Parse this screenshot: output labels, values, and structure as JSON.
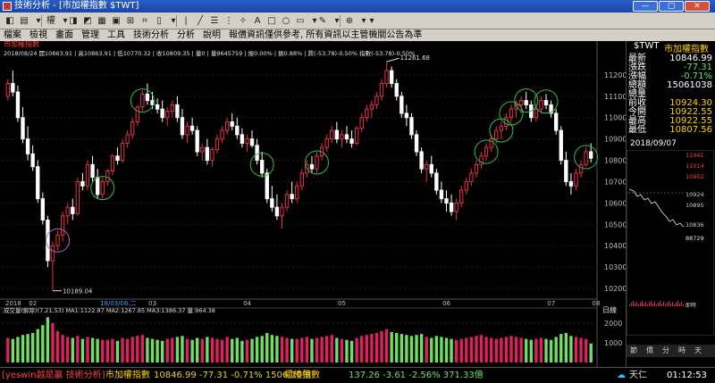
{
  "window": {
    "title": "技術分析 - [市加權指數 $TWT]"
  },
  "toolbar": {
    "items": [
      {
        "label": "◧"
      },
      {
        "label": "▤"
      },
      {
        "label": "▾"
      },
      {
        "label": "權"
      },
      {
        "label": "▾"
      },
      {
        "label": "◨"
      },
      {
        "label": "◩"
      },
      {
        "label": "▦"
      },
      {
        "label": "▣"
      },
      {
        "label": "⊞"
      },
      {
        "label": "⌗"
      },
      {
        "label": "▯"
      },
      {
        "label": "▾"
      },
      {
        "label": "|"
      },
      {
        "label": "╱"
      },
      {
        "label": "☰"
      },
      {
        "label": "⋮"
      },
      {
        "label": "✧"
      },
      {
        "label": "A"
      },
      {
        "label": "□"
      },
      {
        "label": "○"
      },
      {
        "label": "▭"
      },
      {
        "label": "▾"
      },
      {
        "label": "✎"
      },
      {
        "label": "▾"
      },
      {
        "label": "⊕"
      },
      {
        "label": "▾"
      },
      {
        "label": "▾"
      }
    ]
  },
  "menu": {
    "items": [
      "檔案",
      "檢視",
      "畫面",
      "管理",
      "工具",
      "技術分析",
      "分析",
      "說明",
      "報價資訊僅供參考, 所有資訊以主管機關公告為準"
    ]
  },
  "chart": {
    "subtitle": "市加權指數",
    "info_line": "2018/08/24  開10863.91 | 高10863.91 | 低10770.32 | 收10809.35 | 量0 | 量9645759 | 振0.00% | 振0.88% | 跌(-53.78)-0.50%  指數(-53.78)-0.50%",
    "high_label": "11261.68",
    "low_label": "10189.04",
    "price_ticks": [
      "11200",
      "11100",
      "11000",
      "10900",
      "10800",
      "10700",
      "10600",
      "10500",
      "10400",
      "10300",
      "10200"
    ],
    "month_labels": [
      "2018",
      "02",
      "03",
      "04",
      "05",
      "06",
      "07",
      "08"
    ],
    "date_marker": "18/03/06,二",
    "volume_title": "成交量(解除)(7,21,53)  MA1:1122.87  MA2:1267.85  MA3:1386.37  量:964.38",
    "volume_scale": "日線",
    "volume_ticks": [
      "2000",
      "1000"
    ]
  },
  "quote": {
    "symbol": "$TWT",
    "name": "市加權指數",
    "rows": [
      {
        "label": "最新",
        "value": "10846.99"
      },
      {
        "label": "漲跌",
        "value": "-77.31"
      },
      {
        "label": "漲幅",
        "value": "-0.71%"
      },
      {
        "label": "總額",
        "value": "15061038"
      },
      {
        "label": "總量",
        "value": ""
      },
      {
        "label": "前收",
        "value": "10924.30"
      },
      {
        "label": "今開",
        "value": "10922.55"
      },
      {
        "label": "最高",
        "value": "10922.55"
      },
      {
        "label": "最低",
        "value": "10807.56"
      }
    ],
    "date": "2018/09/07",
    "mini_labels": [
      "11041",
      "11014",
      "10952",
      "10924",
      "10895",
      "10836",
      "88729"
    ],
    "mini_axis": "即時",
    "tabs": [
      "節",
      "價",
      "分",
      "時",
      "天"
    ]
  },
  "colors": {
    "up": "#e8304a",
    "down": "#ffffff",
    "vol_up": "#e02060",
    "vol_down": "#70e060",
    "circle": "#30c040",
    "circle_alt": "#c060c0",
    "accent_red": "#ff2020",
    "accent_yellow": "#ffd000"
  },
  "bottom": {
    "brand": "[yeswin越是贏 技術分析]",
    "idx1_name": "市加權指數",
    "idx1_values": "10846.99 -77.31 -0.71% 1506.10億",
    "idx2_name": "櫃檯指數",
    "idx2_values": "137.26 -3.61 -2.56% 371.33億",
    "weather": "天仁",
    "clock": "01:12:53"
  },
  "chart_data": {
    "type": "candlestick",
    "ylim": [
      10150,
      11300
    ],
    "price_axis_ticks": [
      10200,
      10300,
      10400,
      10500,
      10600,
      10700,
      10800,
      10900,
      11000,
      11100,
      11200
    ],
    "candles": [
      [
        11100,
        11180,
        11080,
        11160
      ],
      [
        11160,
        11220,
        11100,
        11120
      ],
      [
        11120,
        11150,
        10980,
        11000
      ],
      [
        11000,
        11050,
        10880,
        10900
      ],
      [
        10900,
        10960,
        10800,
        10830
      ],
      [
        10830,
        10870,
        10750,
        10770
      ],
      [
        10770,
        10800,
        10600,
        10620
      ],
      [
        10620,
        10650,
        10500,
        10520
      ],
      [
        10520,
        10540,
        10300,
        10330
      ],
      [
        10330,
        10420,
        10189,
        10400
      ],
      [
        10400,
        10470,
        10380,
        10450
      ],
      [
        10450,
        10560,
        10420,
        10540
      ],
      [
        10540,
        10600,
        10500,
        10580
      ],
      [
        10580,
        10620,
        10520,
        10550
      ],
      [
        10550,
        10720,
        10540,
        10700
      ],
      [
        10700,
        10740,
        10660,
        10680
      ],
      [
        10680,
        10800,
        10660,
        10780
      ],
      [
        10780,
        10820,
        10700,
        10720
      ],
      [
        10720,
        10760,
        10620,
        10640
      ],
      [
        10640,
        10720,
        10620,
        10700
      ],
      [
        10700,
        10760,
        10680,
        10750
      ],
      [
        10750,
        10830,
        10730,
        10820
      ],
      [
        10820,
        10860,
        10780,
        10800
      ],
      [
        10800,
        10900,
        10790,
        10880
      ],
      [
        10880,
        10940,
        10860,
        10920
      ],
      [
        10920,
        11000,
        10900,
        10980
      ],
      [
        10980,
        11060,
        10960,
        11050
      ],
      [
        11050,
        11130,
        11030,
        11110
      ],
      [
        11110,
        11160,
        11060,
        11080
      ],
      [
        11080,
        11120,
        11040,
        11060
      ],
      [
        11060,
        11090,
        11020,
        11040
      ],
      [
        11040,
        11080,
        10980,
        11000
      ],
      [
        11000,
        11050,
        10960,
        11030
      ],
      [
        11030,
        11080,
        11000,
        11060
      ],
      [
        11060,
        11100,
        10980,
        11000
      ],
      [
        11000,
        11040,
        10900,
        10920
      ],
      [
        10920,
        10980,
        10880,
        10960
      ],
      [
        10960,
        11000,
        10920,
        10940
      ],
      [
        10940,
        10960,
        10820,
        10840
      ],
      [
        10840,
        10880,
        10800,
        10860
      ],
      [
        10860,
        10900,
        10780,
        10800
      ],
      [
        10800,
        10860,
        10770,
        10850
      ],
      [
        10850,
        10920,
        10830,
        10900
      ],
      [
        10900,
        10960,
        10880,
        10940
      ],
      [
        10940,
        11000,
        10920,
        10980
      ],
      [
        10980,
        11020,
        10940,
        10960
      ],
      [
        10960,
        11000,
        10900,
        10920
      ],
      [
        10920,
        10950,
        10860,
        10880
      ],
      [
        10880,
        10920,
        10840,
        10900
      ],
      [
        10900,
        10940,
        10860,
        10870
      ],
      [
        10870,
        10900,
        10780,
        10800
      ],
      [
        10800,
        10840,
        10720,
        10740
      ],
      [
        10740,
        10760,
        10600,
        10620
      ],
      [
        10620,
        10680,
        10560,
        10580
      ],
      [
        10580,
        10640,
        10520,
        10540
      ],
      [
        10540,
        10600,
        10480,
        10580
      ],
      [
        10580,
        10660,
        10560,
        10640
      ],
      [
        10640,
        10700,
        10600,
        10620
      ],
      [
        10620,
        10700,
        10600,
        10680
      ],
      [
        10680,
        10760,
        10660,
        10740
      ],
      [
        10740,
        10800,
        10720,
        10780
      ],
      [
        10780,
        10820,
        10740,
        10760
      ],
      [
        10760,
        10840,
        10740,
        10820
      ],
      [
        10820,
        10880,
        10800,
        10860
      ],
      [
        10860,
        10920,
        10840,
        10900
      ],
      [
        10900,
        10960,
        10880,
        10940
      ],
      [
        10940,
        10980,
        10880,
        10900
      ],
      [
        10900,
        10940,
        10860,
        10920
      ],
      [
        10920,
        10960,
        10880,
        10900
      ],
      [
        10900,
        10940,
        10860,
        10880
      ],
      [
        10880,
        10960,
        10870,
        10950
      ],
      [
        10950,
        11020,
        10930,
        11000
      ],
      [
        11000,
        11060,
        10980,
        11040
      ],
      [
        11040,
        11080,
        11000,
        11060
      ],
      [
        11060,
        11120,
        11040,
        11100
      ],
      [
        11100,
        11180,
        11080,
        11160
      ],
      [
        11160,
        11262,
        11140,
        11220
      ],
      [
        11220,
        11240,
        11140,
        11160
      ],
      [
        11160,
        11180,
        11080,
        11100
      ],
      [
        11100,
        11120,
        11000,
        11020
      ],
      [
        11020,
        11060,
        10960,
        11000
      ],
      [
        11000,
        11020,
        10900,
        10920
      ],
      [
        10920,
        10940,
        10820,
        10840
      ],
      [
        10840,
        10860,
        10740,
        10760
      ],
      [
        10760,
        10800,
        10700,
        10780
      ],
      [
        10780,
        10820,
        10720,
        10740
      ],
      [
        10740,
        10760,
        10640,
        10660
      ],
      [
        10660,
        10700,
        10600,
        10620
      ],
      [
        10620,
        10660,
        10560,
        10600
      ],
      [
        10600,
        10640,
        10540,
        10560
      ],
      [
        10560,
        10620,
        10520,
        10600
      ],
      [
        10600,
        10680,
        10580,
        10660
      ],
      [
        10660,
        10720,
        10640,
        10700
      ],
      [
        10700,
        10760,
        10680,
        10740
      ],
      [
        10740,
        10800,
        10720,
        10780
      ],
      [
        10780,
        10840,
        10760,
        10820
      ],
      [
        10820,
        10880,
        10800,
        10860
      ],
      [
        10860,
        10920,
        10840,
        10900
      ],
      [
        10900,
        10960,
        10880,
        10940
      ],
      [
        10940,
        10980,
        10900,
        10960
      ],
      [
        10960,
        11020,
        10940,
        11000
      ],
      [
        11000,
        11060,
        10980,
        11040
      ],
      [
        11040,
        11080,
        11000,
        11060
      ],
      [
        11060,
        11100,
        11020,
        11080
      ],
      [
        11080,
        11120,
        11040,
        11060
      ],
      [
        11060,
        11080,
        10980,
        11000
      ],
      [
        11000,
        11060,
        10980,
        11040
      ],
      [
        11040,
        11100,
        11020,
        11080
      ],
      [
        11080,
        11110,
        11040,
        11060
      ],
      [
        11060,
        11080,
        11000,
        11020
      ],
      [
        11020,
        11040,
        10920,
        10940
      ],
      [
        10940,
        10960,
        10780,
        10800
      ],
      [
        10800,
        10840,
        10680,
        10700
      ],
      [
        10700,
        10740,
        10640,
        10680
      ],
      [
        10680,
        10760,
        10660,
        10740
      ],
      [
        10740,
        10800,
        10720,
        10780
      ],
      [
        10780,
        10860,
        10770,
        10840
      ],
      [
        10840,
        10880,
        10790,
        10810
      ]
    ],
    "volumes": [
      1250,
      1200,
      1300,
      1400,
      1450,
      1500,
      1700,
      1900,
      2300,
      2000,
      1600,
      1400,
      1300,
      1250,
      1350,
      1200,
      1300,
      1250,
      1200,
      1150,
      1150,
      1200,
      1100,
      1250,
      1200,
      1300,
      1350,
      1400,
      1250,
      1200,
      1150,
      1100,
      1200,
      1250,
      1300,
      1350,
      1200,
      1150,
      1250,
      1200,
      1300,
      1250,
      1200,
      1150,
      1300,
      1200,
      1250,
      1100,
      1150,
      1200,
      1300,
      1350,
      1500,
      1400,
      1350,
      1300,
      1250,
      1200,
      1200,
      1250,
      1300,
      1200,
      1250,
      1300,
      1350,
      1400,
      1250,
      1200,
      1150,
      1100,
      1250,
      1350,
      1400,
      1450,
      1500,
      1600,
      1700,
      1550,
      1500,
      1450,
      1400,
      1350,
      1400,
      1450,
      1300,
      1250,
      1350,
      1300,
      1250,
      1200,
      1150,
      1200,
      1250,
      1300,
      1350,
      1400,
      1300,
      1250,
      1200,
      1250,
      1300,
      1350,
      1300,
      1250,
      1200,
      1150,
      1200,
      1250,
      1200,
      1150,
      1300,
      1450,
      1500,
      1350,
      1300,
      1250,
      1200,
      965
    ]
  }
}
